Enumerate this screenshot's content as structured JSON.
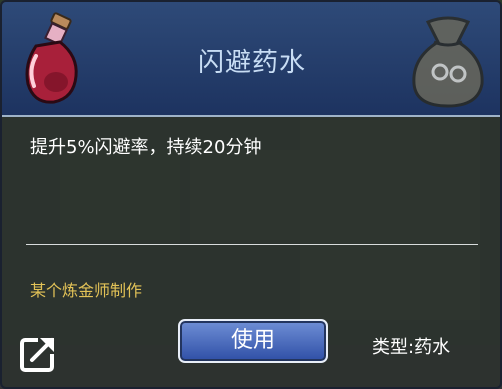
{
  "item": {
    "name": "闪避药水",
    "description": "提升5%闪避率，持续20分钟",
    "crafter": "某个炼金师制作",
    "type_label": "类型:药水"
  },
  "actions": {
    "use_label": "使用"
  },
  "icons": {
    "item": "red-potion-icon",
    "category": "pouch-icon",
    "share": "share-icon"
  },
  "colors": {
    "header": "#1d3360",
    "title": "#c8ddf4",
    "crafter": "#e2c257",
    "use_button": "#4a6cc0"
  }
}
